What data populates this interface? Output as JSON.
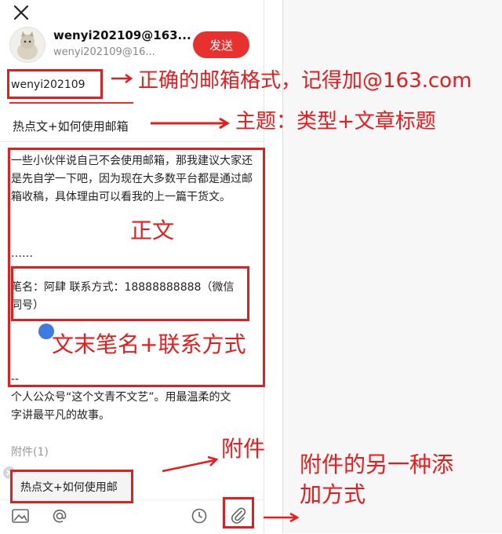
{
  "account": {
    "name": "wenyi202109@163...",
    "address": "wenyi202109@16..."
  },
  "compose": {
    "send_label": "发送",
    "to_value": "wenyi202109",
    "subject": "热点文+如何使用邮箱",
    "body_paragraph_1": "一些小伙伴说自己不会使用邮箱，那我建议大家还是先自学一下吧，因为现在大多数平台都是通过邮箱收稿，具体理由可以看我的上一篇干货文。",
    "body_ellipsis": "……",
    "signature_line_1": "笔名：阿肆 联系方式：18888888888（微信",
    "signature_line_2": "同号）",
    "separator": "--",
    "footer_line_1": "个人公众号“这个文青不文艺”。用最温柔的文",
    "footer_line_2": "字讲最平凡的故事。",
    "attachment_label": "附件(1)",
    "attachment_name": "热点文+如何使用邮"
  },
  "annotations": {
    "email_hint": "正确的邮箱格式，记得加@163.com",
    "subject_hint": "主题：类型+文章标题",
    "body_hint": "正文",
    "signature_hint": "文末笔名+联系方式",
    "attachment_hint": "附件",
    "attachment_alt_hint_1": "附件的另一种添",
    "attachment_alt_hint_2": "加方式"
  },
  "colors": {
    "accent": "#e8312e",
    "annotation": "#e81c1c",
    "cursor": "#3d7be0"
  },
  "icons": [
    "close-icon",
    "image-icon",
    "at-icon",
    "clock-icon",
    "paperclip-icon"
  ]
}
